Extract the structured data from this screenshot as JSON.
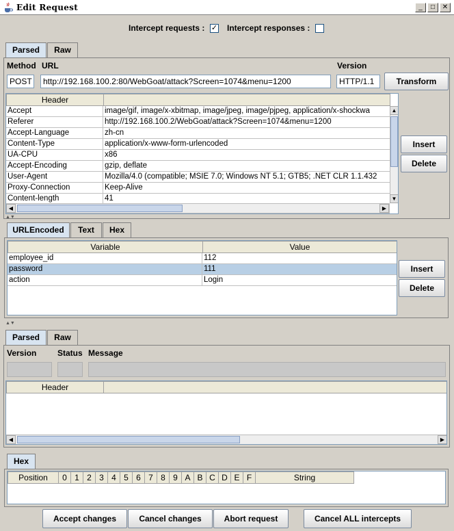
{
  "window": {
    "title": "Edit Request"
  },
  "intercept": {
    "requests_label": "Intercept requests :",
    "responses_label": "Intercept responses :",
    "requests_checked": "✓",
    "responses_checked": ""
  },
  "request_tabs": [
    "Parsed",
    "Raw"
  ],
  "request_line": {
    "method_label": "Method",
    "url_label": "URL",
    "version_label": "Version",
    "method": "POST",
    "url": "http://192.168.100.2:80/WebGoat/attack?Screen=1074&menu=1200",
    "version": "HTTP/1.1",
    "transform_label": "Transform"
  },
  "headers_table": {
    "columns": [
      "Header",
      ""
    ],
    "rows": [
      [
        "Accept",
        "image/gif, image/x-xbitmap, image/jpeg, image/pjpeg, application/x-shockwa"
      ],
      [
        "Referer",
        "http://192.168.100.2/WebGoat/attack?Screen=1074&menu=1200"
      ],
      [
        "Accept-Language",
        "zh-cn"
      ],
      [
        "Content-Type",
        "application/x-www-form-urlencoded"
      ],
      [
        "UA-CPU",
        "x86"
      ],
      [
        "Accept-Encoding",
        "gzip, deflate"
      ],
      [
        "User-Agent",
        "Mozilla/4.0 (compatible; MSIE 7.0; Windows NT 5.1; GTB5; .NET CLR 1.1.432"
      ],
      [
        "Proxy-Connection",
        "Keep-Alive"
      ],
      [
        "Content-length",
        "41"
      ]
    ],
    "insert_label": "Insert",
    "delete_label": "Delete"
  },
  "body_tabs": [
    "URLEncoded",
    "Text",
    "Hex"
  ],
  "params_table": {
    "columns": [
      "Variable",
      "Value"
    ],
    "rows": [
      [
        "employee_id",
        "112"
      ],
      [
        "password",
        "111"
      ],
      [
        "action",
        "Login"
      ]
    ],
    "insert_label": "Insert",
    "delete_label": "Delete"
  },
  "response_tabs": [
    "Parsed",
    "Raw"
  ],
  "response": {
    "version_label": "Version",
    "status_label": "Status",
    "message_label": "Message",
    "header_col": "Header"
  },
  "hex": {
    "tab": "Hex",
    "columns": [
      "Position",
      "0",
      "1",
      "2",
      "3",
      "4",
      "5",
      "6",
      "7",
      "8",
      "9",
      "A",
      "B",
      "C",
      "D",
      "E",
      "F",
      "String"
    ]
  },
  "footer": {
    "accept": "Accept changes",
    "cancel": "Cancel changes",
    "abort": "Abort request",
    "cancel_all": "Cancel ALL intercepts"
  }
}
